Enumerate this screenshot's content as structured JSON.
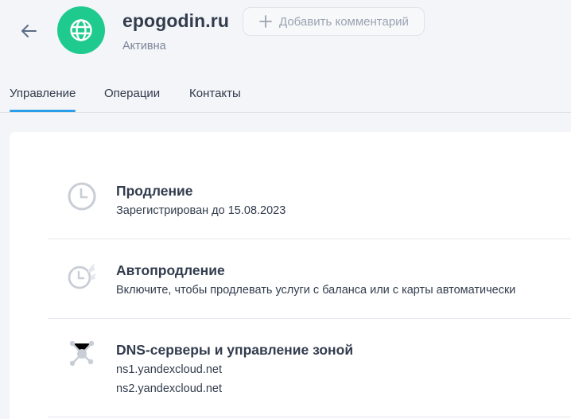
{
  "header": {
    "back_icon": "arrow-left-icon",
    "avatar_icon": "globe-icon",
    "avatar_color": "#1fca8e",
    "title": "epogodin.ru",
    "status": "Активна",
    "add_comment_label": "Добавить комментарий"
  },
  "tabs": [
    {
      "label": "Управление",
      "active": true
    },
    {
      "label": "Операции",
      "active": false
    },
    {
      "label": "Контакты",
      "active": false
    }
  ],
  "sections": [
    {
      "icon": "clock-icon",
      "title": "Продление",
      "lines": [
        "Зарегистрирован до 15.08.2023"
      ]
    },
    {
      "icon": "autorenew-clock-icon",
      "title": "Автопродление",
      "lines": [
        "Включите, чтобы продлевать услуги с баланса или с карты автоматически"
      ]
    },
    {
      "icon": "network-nodes-icon",
      "title": "DNS-серверы и управление зоной",
      "lines": [
        "ns1.yandexcloud.net",
        "ns2.yandexcloud.net"
      ]
    }
  ],
  "colors": {
    "accent": "#2b9eea",
    "text": "#323c4d",
    "muted": "#7b8698"
  }
}
